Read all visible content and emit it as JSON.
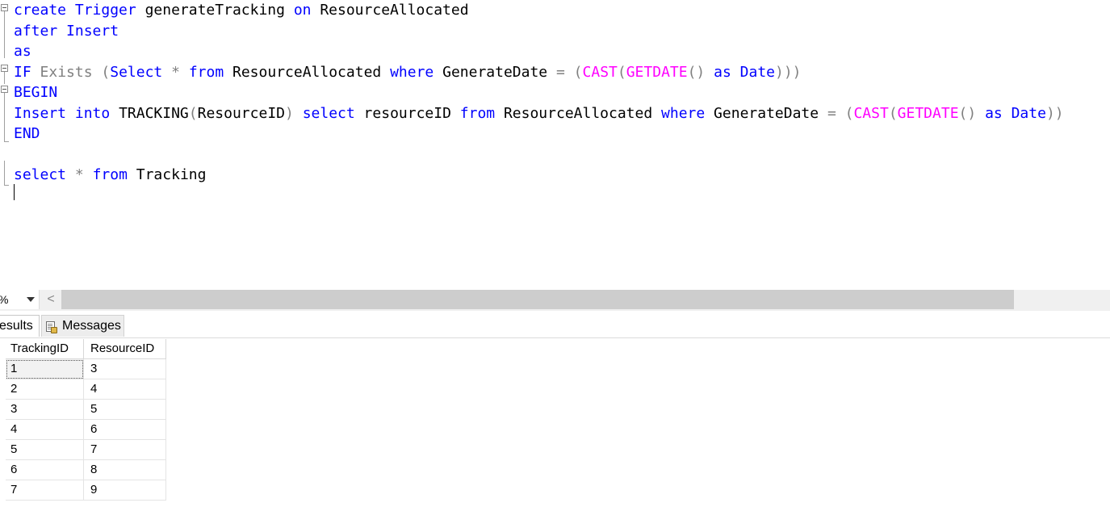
{
  "editor": {
    "lines": [
      [
        {
          "t": "create",
          "c": "kw"
        },
        {
          "t": " "
        },
        {
          "t": "Trigger",
          "c": "kw"
        },
        {
          "t": " generateTracking ",
          "c": "id"
        },
        {
          "t": "on",
          "c": "kw"
        },
        {
          "t": " ResourceAllocated",
          "c": "id"
        }
      ],
      [
        {
          "t": "after",
          "c": "kw"
        },
        {
          "t": " "
        },
        {
          "t": "Insert",
          "c": "kw"
        }
      ],
      [
        {
          "t": "as",
          "c": "kw"
        }
      ],
      [
        {
          "t": "IF",
          "c": "kw"
        },
        {
          "t": " "
        },
        {
          "t": "Exists",
          "c": "gray"
        },
        {
          "t": " ",
          "c": "id"
        },
        {
          "t": "(",
          "c": "gray"
        },
        {
          "t": "Select",
          "c": "kw"
        },
        {
          "t": " ",
          "c": "id"
        },
        {
          "t": "*",
          "c": "gray"
        },
        {
          "t": " "
        },
        {
          "t": "from",
          "c": "kw"
        },
        {
          "t": " ResourceAllocated ",
          "c": "id"
        },
        {
          "t": "where",
          "c": "kw"
        },
        {
          "t": " GenerateDate ",
          "c": "id"
        },
        {
          "t": "=",
          "c": "gray"
        },
        {
          "t": " "
        },
        {
          "t": "(",
          "c": "gray"
        },
        {
          "t": "CAST",
          "c": "fn"
        },
        {
          "t": "(",
          "c": "gray"
        },
        {
          "t": "GETDATE",
          "c": "fn"
        },
        {
          "t": "()",
          "c": "gray"
        },
        {
          "t": " "
        },
        {
          "t": "as",
          "c": "kw"
        },
        {
          "t": " "
        },
        {
          "t": "Date",
          "c": "kw"
        },
        {
          "t": ")))",
          "c": "gray"
        }
      ],
      [
        {
          "t": "BEGIN",
          "c": "kw"
        }
      ],
      [
        {
          "t": "Insert",
          "c": "kw"
        },
        {
          "t": " "
        },
        {
          "t": "into",
          "c": "kw"
        },
        {
          "t": " TRACKING",
          "c": "id"
        },
        {
          "t": "(",
          "c": "gray"
        },
        {
          "t": "ResourceID",
          "c": "id"
        },
        {
          "t": ")",
          "c": "gray"
        },
        {
          "t": " "
        },
        {
          "t": "select",
          "c": "kw"
        },
        {
          "t": " resourceID ",
          "c": "id"
        },
        {
          "t": "from",
          "c": "kw"
        },
        {
          "t": " ResourceAllocated ",
          "c": "id"
        },
        {
          "t": "where",
          "c": "kw"
        },
        {
          "t": " GenerateDate ",
          "c": "id"
        },
        {
          "t": "=",
          "c": "gray"
        },
        {
          "t": " "
        },
        {
          "t": "(",
          "c": "gray"
        },
        {
          "t": "CAST",
          "c": "fn"
        },
        {
          "t": "(",
          "c": "gray"
        },
        {
          "t": "GETDATE",
          "c": "fn"
        },
        {
          "t": "()",
          "c": "gray"
        },
        {
          "t": " "
        },
        {
          "t": "as",
          "c": "kw"
        },
        {
          "t": " "
        },
        {
          "t": "Date",
          "c": "kw"
        },
        {
          "t": "))",
          "c": "gray"
        }
      ],
      [
        {
          "t": "END",
          "c": "kw"
        }
      ],
      [],
      [
        {
          "t": "select",
          "c": "kw"
        },
        {
          "t": " "
        },
        {
          "t": "*",
          "c": "gray"
        },
        {
          "t": " "
        },
        {
          "t": "from",
          "c": "kw"
        },
        {
          "t": " Tracking",
          "c": "id"
        }
      ]
    ],
    "colors": {
      "keyword": "#0000ff",
      "gray": "#808080",
      "function": "#ff00ff",
      "identifier": "#000000"
    }
  },
  "zoom": {
    "value": "%",
    "dropdown_icon": "triangle-down-icon"
  },
  "scroll": {
    "left_arrow": "<"
  },
  "tabs": {
    "results_label": "esults",
    "messages_label": "Messages",
    "messages_icon": "messages-icon"
  },
  "grid": {
    "columns": [
      "TrackingID",
      "ResourceID"
    ],
    "rows": [
      [
        "1",
        "3"
      ],
      [
        "2",
        "4"
      ],
      [
        "3",
        "5"
      ],
      [
        "4",
        "6"
      ],
      [
        "5",
        "7"
      ],
      [
        "6",
        "8"
      ],
      [
        "7",
        "9"
      ]
    ]
  }
}
